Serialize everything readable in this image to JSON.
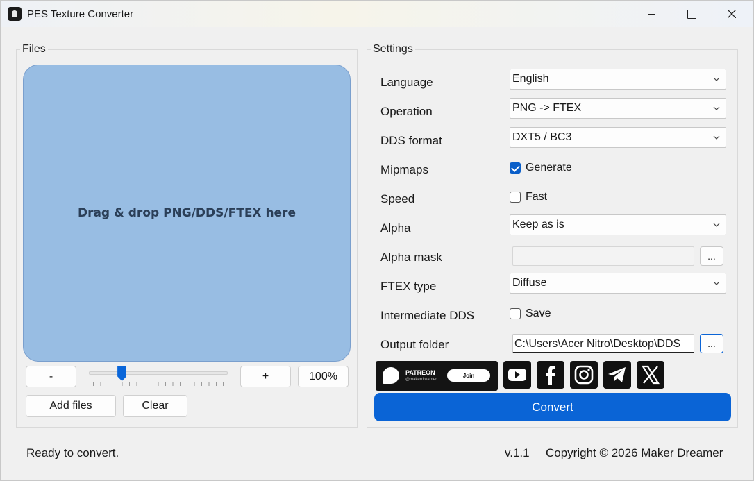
{
  "window": {
    "title": "PES Texture Converter"
  },
  "files": {
    "group_title": "Files",
    "dropzone_text": "Drag & drop PNG/DDS/FTEX here",
    "zoom_out_label": "-",
    "zoom_in_label": "+",
    "zoom_value": "100%",
    "zoom_slider_fraction": 0.22,
    "add_files_label": "Add files",
    "clear_label": "Clear"
  },
  "settings": {
    "group_title": "Settings",
    "language": {
      "label": "Language",
      "value": "English"
    },
    "operation": {
      "label": "Operation",
      "value": "PNG -> FTEX"
    },
    "dds_format": {
      "label": "DDS format",
      "value": "DXT5 / BC3"
    },
    "mipmaps": {
      "label": "Mipmaps",
      "option": "Generate",
      "checked": true
    },
    "speed": {
      "label": "Speed",
      "option": "Fast",
      "checked": false
    },
    "alpha": {
      "label": "Alpha",
      "value": "Keep as is"
    },
    "alpha_mask": {
      "label": "Alpha mask",
      "value": "",
      "browse_label": "..."
    },
    "ftex_type": {
      "label": "FTEX type",
      "value": "Diffuse"
    },
    "intermediate_dds": {
      "label": "Intermediate DDS",
      "option": "Save",
      "checked": false
    },
    "output_folder": {
      "label": "Output folder",
      "value": "C:\\Users\\Acer Nitro\\Desktop\\DDS",
      "browse_label": "..."
    }
  },
  "promo": {
    "patreon_name": "PATREON",
    "patreon_handle": "@makerdreamer",
    "patreon_join": "Join",
    "social_icons": [
      "youtube-icon",
      "facebook-icon",
      "instagram-icon",
      "telegram-icon",
      "x-icon"
    ]
  },
  "convert_label": "Convert",
  "footer": {
    "status": "Ready to convert.",
    "version": "v.1.1",
    "copyright": "Copyright © 2026 Maker Dreamer"
  },
  "colors": {
    "accent": "#0a64d6",
    "dropzone": "#98bde3"
  }
}
